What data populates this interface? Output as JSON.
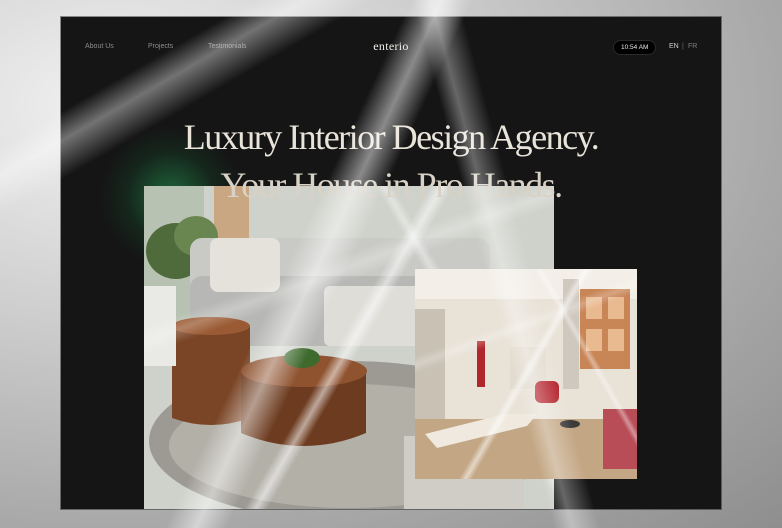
{
  "nav": {
    "links": [
      "About Us",
      "Projects",
      "Testimonials"
    ],
    "logo": "enterio",
    "time": "10:54 AM",
    "lang_active": "EN",
    "lang_separator": "|",
    "lang_other": "FR"
  },
  "hero": {
    "line1": "Luxury Interior Design Agency.",
    "line2": "Your House in Pro Hands."
  },
  "colors": {
    "page_bg": "#151515",
    "headline": "#e9e4da",
    "accent_glow": "#28aa5a"
  }
}
